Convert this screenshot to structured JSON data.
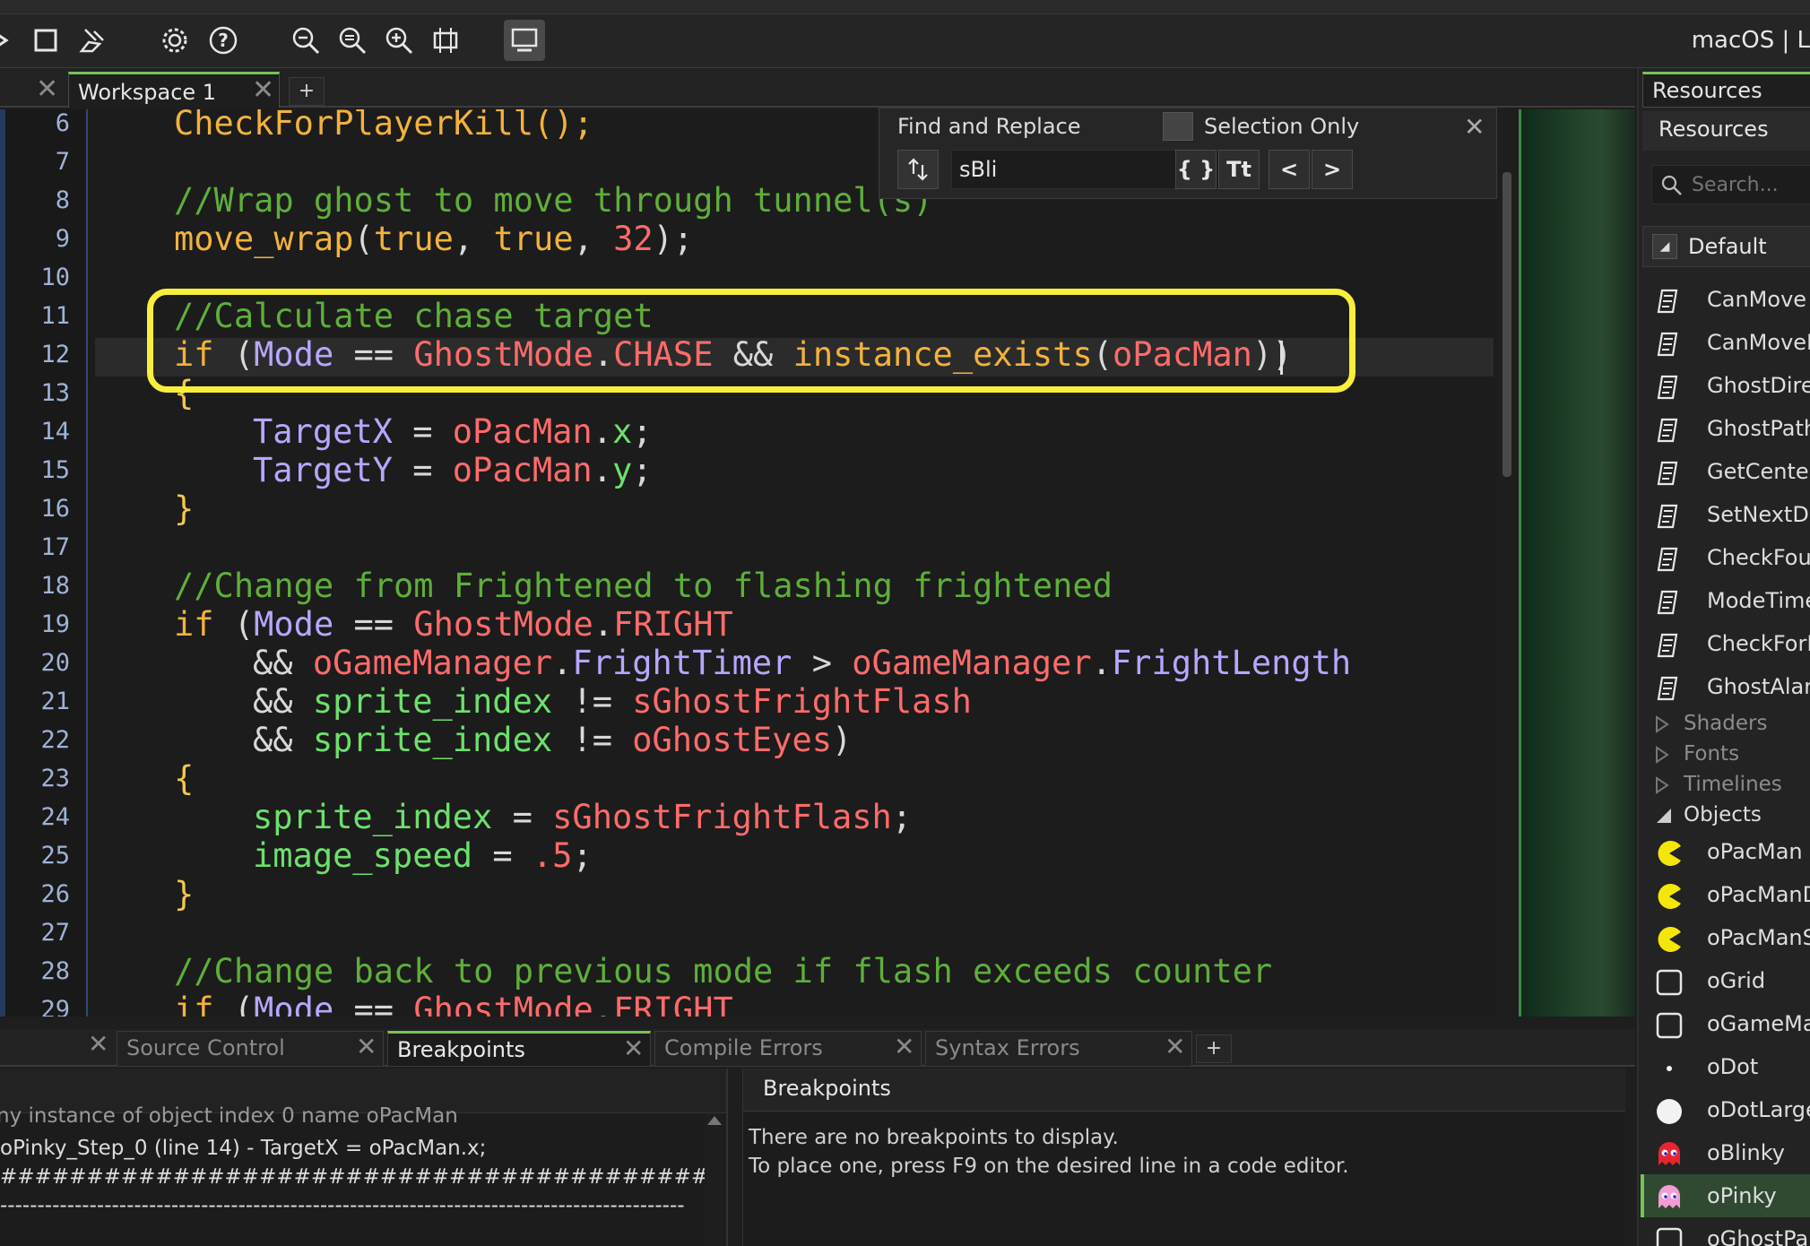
{
  "toolbar": {
    "platform": "macOS | L",
    "icons": [
      "run-icon",
      "stop-icon",
      "clean-icon",
      "settings-icon",
      "help-icon",
      "zoom-out-icon",
      "zoom-reset-icon",
      "zoom-in-icon",
      "expand-icon",
      "device-icon"
    ]
  },
  "workspace": {
    "tab_label": "Workspace 1",
    "add_label": "+"
  },
  "editor": {
    "line_numbers": [
      "6",
      "7",
      "8",
      "9",
      "10",
      "11",
      "12",
      "13",
      "14",
      "15",
      "16",
      "17",
      "18",
      "19",
      "20",
      "21",
      "22",
      "23",
      "24",
      "25",
      "26",
      "27",
      "28",
      "29"
    ],
    "lines": {
      "l6": "CheckForPlayerKill();",
      "l8": "//Wrap ghost to move through tunnel(s)",
      "l9_fn": "move_wrap",
      "l9_a": "(",
      "l9_t1": "true",
      "l9_c1": ", ",
      "l9_t2": "true",
      "l9_c2": ", ",
      "l9_n": "32",
      "l9_end": ");",
      "l11": "//Calculate chase target",
      "l12_if": "if",
      "l12_p": " (",
      "l12_mode": "Mode",
      "l12_eq": " == ",
      "l12_gm": "GhostMode",
      "l12_dot": ".",
      "l12_chase": "CHASE",
      "l12_and": " && ",
      "l12_fn": "instance_exists",
      "l12_po": "(",
      "l12_obj": "oPacMan",
      "l12_pc": "))",
      "l13": "{",
      "l14_v": "TargetX",
      "l14_eq": " = ",
      "l14_o": "oPacMan",
      "l14_d": ".",
      "l14_x": "x",
      "l14_s": ";",
      "l15_v": "TargetY",
      "l15_eq": " = ",
      "l15_o": "oPacMan",
      "l15_d": ".",
      "l15_y": "y",
      "l15_s": ";",
      "l16": "}",
      "l18": "//Change from Frightened to flashing frightened",
      "l19_if": "if",
      "l19_p": " (",
      "l19_mode": "Mode",
      "l19_eq": " == ",
      "l19_gm": "GhostMode",
      "l19_dot": ".",
      "l19_fr": "FRIGHT",
      "l20_and": "&& ",
      "l20_gm": "oGameManager",
      "l20_d": ".",
      "l20_ft": "FrightTimer",
      "l20_gt": " > ",
      "l20_gm2": "oGameManager",
      "l20_d2": ".",
      "l20_fl": "FrightLength",
      "l21_and": "&& ",
      "l21_si": "sprite_index",
      "l21_ne": " != ",
      "l21_sp": "sGhostFrightFlash",
      "l22_and": "&& ",
      "l22_si": "sprite_index",
      "l22_ne": " != ",
      "l22_sp": "oGhostEyes",
      "l22_pc": ")",
      "l23": "{",
      "l24_si": "sprite_index",
      "l24_eq": " = ",
      "l24_sp": "sGhostFrightFlash",
      "l24_s": ";",
      "l25_is": "image_speed",
      "l25_eq": " = ",
      "l25_n": ".5",
      "l25_s": ";",
      "l26": "}",
      "l28": "//Change back to previous mode if flash exceeds counter",
      "l29_if": "if",
      "l29_p": " (",
      "l29_mode": "Mode",
      "l29_eq": " == ",
      "l29_gm": "GhostMode",
      "l29_dot": ".",
      "l29_fr": "FRIGHT"
    }
  },
  "find": {
    "title": "Find and Replace",
    "selection_only": "Selection Only",
    "value": "sBli",
    "regex_label": "{ }",
    "case_label": "Tt",
    "prev_label": "<",
    "next_label": ">"
  },
  "resources": {
    "tab_label": "Resources",
    "header": "Resources",
    "search_placeholder": "Search...",
    "group": "Default",
    "scripts": [
      "CanMove",
      "CanMoveF",
      "GhostDire",
      "GhostPath",
      "GetCenter",
      "SetNextDir",
      "CheckFour",
      "ModeTime",
      "CheckForP",
      "GhostAlarm"
    ],
    "folders": [
      "Shaders",
      "Fonts",
      "Timelines"
    ],
    "objects_label": "Objects",
    "objects": [
      "oPacMan",
      "oPacManD",
      "oPacManSt",
      "oGrid",
      "oGameMan",
      "oDot",
      "oDotLarge",
      "oBlinky",
      "oPinky",
      "oGhostPar"
    ],
    "selected": "oPinky"
  },
  "bottom": {
    "tabs": [
      "Source Control",
      "Breakpoints",
      "Compile Errors",
      "Syntax Errors"
    ],
    "active_tab": "Breakpoints",
    "add_label": "+",
    "output_line0": "ny instance of object index 0 name oPacMan",
    "output_line1": "oPinky_Step_0 (line 14) -       TargetX = oPacMan.x;",
    "output_line2": "############################################################################",
    "output_line3": "--------------------------------------------------------------------------------------------",
    "bp_title": "Breakpoints",
    "bp_msg1": "There are no breakpoints to display.",
    "bp_msg2": "To place one, press F9 on the desired line in a code editor."
  },
  "colors": {
    "accent": "#78c257",
    "highlight": "#f7ef3c",
    "comment": "#5fae3a",
    "keyword": "#f2b23c",
    "variable": "#b8a6ff",
    "resource": "#ff6b6b",
    "builtin": "#6ce06c"
  }
}
